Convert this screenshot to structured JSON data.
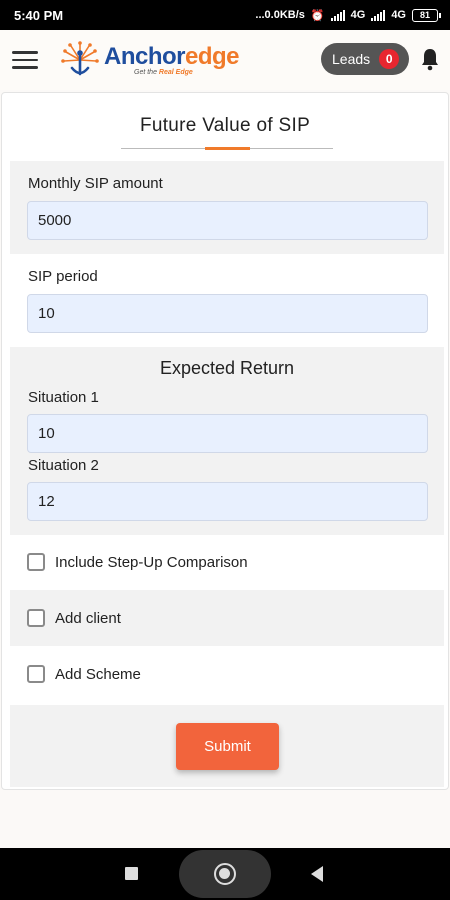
{
  "status_bar": {
    "time": "5:40 PM",
    "net_speed": "...0.0KB/s",
    "network_1": "4G",
    "network_2": "4G",
    "battery": "81"
  },
  "header": {
    "logo_name_1": "Anchor",
    "logo_name_2": "edge",
    "logo_tagline_1": "Get the",
    "logo_tagline_2": "Real Edge",
    "leads_label": "Leads",
    "leads_count": "0"
  },
  "form": {
    "title": "Future Value of SIP",
    "monthly_sip": {
      "label": "Monthly SIP amount",
      "value": "5000"
    },
    "sip_period": {
      "label": "SIP period",
      "value": "10"
    },
    "expected_return": {
      "title": "Expected Return",
      "situation_1": {
        "label": "Situation 1",
        "value": "10"
      },
      "situation_2": {
        "label": "Situation 2",
        "value": "12"
      }
    },
    "checkboxes": {
      "step_up": "Include Step-Up Comparison",
      "add_client": "Add client",
      "add_scheme": "Add Scheme"
    },
    "submit_label": "Submit"
  },
  "colors": {
    "accent": "#f07a2a",
    "submit": "#f2643c",
    "brand_blue": "#1f4e9e",
    "input_bg": "#e8f0fe"
  }
}
